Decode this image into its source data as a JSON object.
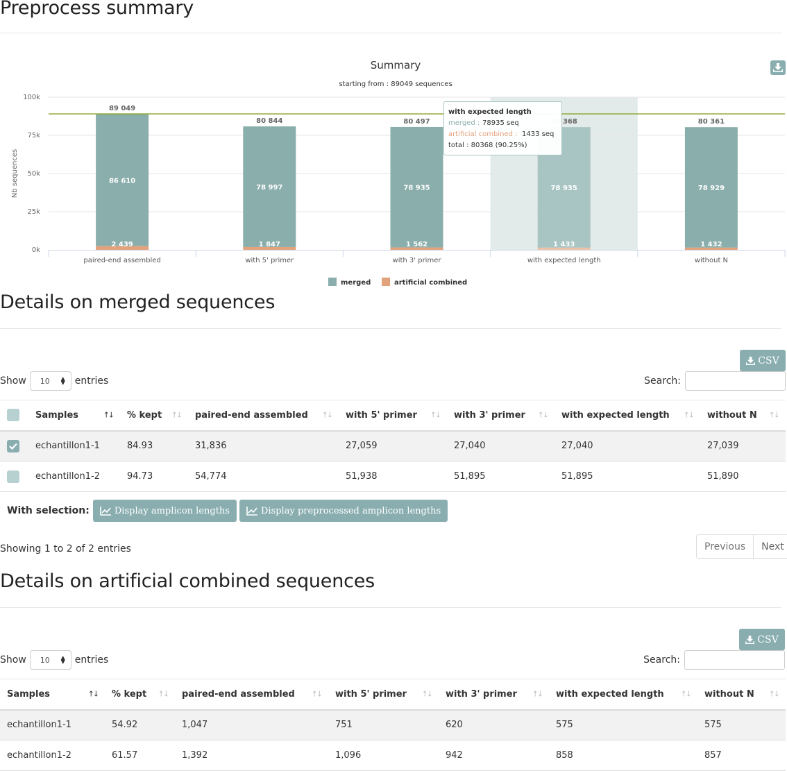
{
  "sections": {
    "preprocess_title": "Preprocess summary",
    "merged_title": "Details on merged sequences",
    "artificial_title": "Details on artificial combined sequences"
  },
  "chart_data": {
    "type": "bar",
    "stacked": true,
    "title": "Summary",
    "subtitle": "starting from : 89049 sequences",
    "ylabel": "Nb sequences",
    "ylim": [
      0,
      100000
    ],
    "yticks": [
      "0k",
      "25k",
      "50k",
      "75k",
      "100k"
    ],
    "categories": [
      "paired-end assembled",
      "with 5' primer",
      "with 3' primer",
      "with expected length",
      "without N"
    ],
    "series": [
      {
        "name": "merged",
        "values": [
          86610,
          78997,
          78935,
          78935,
          78929
        ],
        "labels": [
          "86 610",
          "78 997",
          "78 935",
          "78 935",
          "78 929"
        ],
        "color": "#8aaeab"
      },
      {
        "name": "artificial combined",
        "values": [
          2439,
          1847,
          1562,
          1433,
          1432
        ],
        "labels": [
          "2 439",
          "1 847",
          "1 562",
          "1 433",
          "1 432"
        ],
        "color": "#e2a27c"
      }
    ],
    "totals": [
      89049,
      80844,
      80497,
      80368,
      80361
    ],
    "total_labels": [
      "89 049",
      "80 844",
      "80 497",
      "80 368",
      "80 361"
    ],
    "reference_line": 89049,
    "reference_color": "#8aa427",
    "highlighted_index": 3,
    "legend_position": "bottom-center",
    "tooltip": {
      "title": "with expected length",
      "merged_label": "merged :",
      "merged_value": "78935 seq",
      "artificial_label": "artificial combined :",
      "artificial_value": "1433 seq",
      "total_text": "total : 80368 (90.25%)"
    }
  },
  "colors": {
    "accent": "#8aaeb0",
    "merged": "#8aaeab",
    "artificial": "#e2a27c",
    "reference": "#8aa427"
  },
  "controls": {
    "show_label": "Show",
    "entries_label": "entries",
    "length_value": "10",
    "search_label": "Search:",
    "csv_label": "CSV",
    "with_selection_label": "With selection:",
    "display_amplicon_btn": "Display amplicon lengths",
    "display_preprocessed_btn": "Display preprocessed amplicon lengths",
    "previous_label": "Previous",
    "next_label": "Next"
  },
  "merged_table": {
    "headers": [
      "Samples",
      "% kept",
      "paired-end assembled",
      "with 5' primer",
      "with 3' primer",
      "with expected length",
      "without N"
    ],
    "rows": [
      {
        "checked": true,
        "cells": [
          "echantillon1-1",
          "84.93",
          "31,836",
          "27,059",
          "27,040",
          "27,040",
          "27,039"
        ]
      },
      {
        "checked": false,
        "cells": [
          "echantillon1-2",
          "94.73",
          "54,774",
          "51,938",
          "51,895",
          "51,895",
          "51,890"
        ]
      }
    ],
    "info": "Showing 1 to 2 of 2 entries"
  },
  "artificial_table": {
    "headers": [
      "Samples",
      "% kept",
      "paired-end assembled",
      "with 5' primer",
      "with 3' primer",
      "with expected length",
      "without N"
    ],
    "rows": [
      {
        "cells": [
          "echantillon1-1",
          "54.92",
          "1,047",
          "751",
          "620",
          "575",
          "575"
        ]
      },
      {
        "cells": [
          "echantillon1-2",
          "61.57",
          "1,392",
          "1,096",
          "942",
          "858",
          "857"
        ]
      }
    ]
  }
}
